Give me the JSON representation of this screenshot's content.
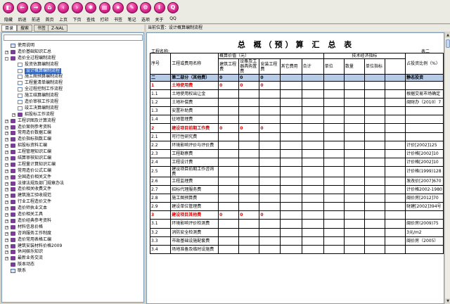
{
  "toolbar": {
    "buttons": [
      {
        "label": "隐藏",
        "icon": "hide-icon",
        "glyph": "◧"
      },
      {
        "label": "后退",
        "icon": "back-icon",
        "glyph": "←"
      },
      {
        "label": "前进",
        "icon": "forward-icon",
        "glyph": "→"
      },
      {
        "label": "首页",
        "icon": "home-icon",
        "glyph": "⌂"
      },
      {
        "label": "上页",
        "icon": "prev-page-icon",
        "glyph": "‹"
      },
      {
        "label": "下页",
        "icon": "next-page-icon",
        "glyph": "›"
      },
      {
        "label": "查找",
        "icon": "find-icon",
        "glyph": "✱"
      },
      {
        "label": "打印",
        "icon": "print-icon",
        "glyph": "▤"
      },
      {
        "label": "书签",
        "icon": "bookmark-icon",
        "glyph": "★"
      },
      {
        "label": "笔记",
        "icon": "note-icon",
        "glyph": "✎"
      },
      {
        "label": "选项",
        "icon": "options-icon",
        "glyph": "⚙"
      },
      {
        "label": "关于",
        "icon": "about-icon",
        "glyph": "i"
      },
      {
        "label": "QQ",
        "icon": "qq-icon",
        "glyph": "Q"
      }
    ],
    "accent": "#d9268c"
  },
  "tabs": [
    "目录",
    "搜索",
    "书签",
    "Z-NAL"
  ],
  "location": "当前位置：设计概算编制流程",
  "sidebar": {
    "tree": [
      {
        "label": "使用说明",
        "level": 0,
        "exp": "",
        "icon": "q"
      },
      {
        "label": "造价基础知识汇总",
        "level": 0,
        "exp": "+",
        "icon": "book"
      },
      {
        "label": "造价全过程编制流程",
        "level": 0,
        "exp": "-",
        "icon": "book"
      },
      {
        "label": "投资估算编制流程",
        "level": 1,
        "exp": "",
        "icon": "doc"
      },
      {
        "label": "设计概算编制流程",
        "level": 1,
        "exp": "",
        "icon": "doc",
        "selected": true
      },
      {
        "label": "施工图预算编制流程",
        "level": 1,
        "exp": "",
        "icon": "doc"
      },
      {
        "label": "工程量清单编制流程",
        "level": 1,
        "exp": "",
        "icon": "doc"
      },
      {
        "label": "全过程控制工作流程",
        "level": 1,
        "exp": "",
        "icon": "doc"
      },
      {
        "label": "施工结算编制流程",
        "level": 1,
        "exp": "",
        "icon": "doc"
      },
      {
        "label": "造价审核工作流程",
        "level": 1,
        "exp": "",
        "icon": "doc"
      },
      {
        "label": "竣工决算编制流程",
        "level": 1,
        "exp": "",
        "icon": "doc"
      },
      {
        "label": "招投标工作流程",
        "level": 1,
        "exp": "+",
        "icon": "book"
      },
      {
        "label": "工程识图及计算流程",
        "level": 0,
        "exp": "+",
        "icon": "book"
      },
      {
        "label": "造价案例参考资料",
        "level": 0,
        "exp": "+",
        "icon": "book"
      },
      {
        "label": "常用造价数据汇编",
        "level": 0,
        "exp": "+",
        "icon": "book"
      },
      {
        "label": "造价指标指数汇编",
        "level": 0,
        "exp": "+",
        "icon": "book"
      },
      {
        "label": "招投标资料汇编",
        "level": 0,
        "exp": "+",
        "icon": "book"
      },
      {
        "label": "工程管理知识汇编",
        "level": 0,
        "exp": "+",
        "icon": "book"
      },
      {
        "label": "结算审核知识汇编",
        "level": 0,
        "exp": "+",
        "icon": "book"
      },
      {
        "label": "工程量计算知识汇编",
        "level": 0,
        "exp": "+",
        "icon": "book"
      },
      {
        "label": "常用造价公式汇编",
        "level": 0,
        "exp": "+",
        "icon": "book"
      },
      {
        "label": "全国造价相关文件",
        "level": 0,
        "exp": "+",
        "icon": "book"
      },
      {
        "label": "法律法规及部门规章办法",
        "level": 0,
        "exp": "+",
        "icon": "book"
      },
      {
        "label": "造价相关收费文件",
        "level": 0,
        "exp": "+",
        "icon": "book"
      },
      {
        "label": "建筑施工验收规范",
        "level": 0,
        "exp": "+",
        "icon": "book"
      },
      {
        "label": "行业工程造价文件",
        "level": 0,
        "exp": "+",
        "icon": "book"
      },
      {
        "label": "造价师执业文本",
        "level": 0,
        "exp": "+",
        "icon": "book"
      },
      {
        "label": "造价相关工具",
        "level": 0,
        "exp": "+",
        "icon": "book"
      },
      {
        "label": "造价经典参考资料",
        "level": 0,
        "exp": "+",
        "icon": "book"
      },
      {
        "label": "材料信息价格",
        "level": 0,
        "exp": "+",
        "icon": "book"
      },
      {
        "label": "咨询服务工作制度",
        "level": 0,
        "exp": "+",
        "icon": "book"
      },
      {
        "label": "造价常用表格汇编",
        "level": 0,
        "exp": "+",
        "icon": "book"
      },
      {
        "label": "建筑安装材料价格2009",
        "level": 0,
        "exp": "+",
        "icon": "book"
      },
      {
        "label": "休闲娱乐知识",
        "level": 0,
        "exp": "+",
        "icon": "book"
      },
      {
        "label": "最新业务交流",
        "level": 0,
        "exp": "+",
        "icon": "book"
      },
      {
        "label": "版本动态",
        "level": 0,
        "exp": "",
        "icon": "book"
      },
      {
        "label": "联系",
        "level": 0,
        "exp": "",
        "icon": "q"
      }
    ]
  },
  "content": {
    "title": "总 概（预）算 汇 总 表",
    "project_label": "工程名称:",
    "table_label": "表二",
    "headers": {
      "no": "序号",
      "name": "工程或费用名称",
      "group_value": "概算价值（元）",
      "building": "建筑工程费",
      "equipment": "设备及工器具购置费",
      "install": "安装工程费",
      "other": "其它费用",
      "total": "合计",
      "group_tech": "技术经济指标",
      "unit": "单位",
      "qty": "数量",
      "unit_index": "单位指标",
      "ratio": "占投资比例（%）",
      "note": "备注及工程建设其他费用计算依据"
    },
    "rows": [
      {
        "type": "part",
        "no": "二",
        "name": "第二部分（其他费）",
        "b": "0",
        "e": "0",
        "i": "0",
        "note": "静态投资"
      },
      {
        "type": "sec",
        "no": "1",
        "name": "土地使用费",
        "b": "0",
        "e": "0",
        "i": "0",
        "note": ""
      },
      {
        "type": "item",
        "no": "1.1",
        "name": "土地使用权出让金",
        "note": "根据交易市场确定"
      },
      {
        "type": "item",
        "no": "1.2",
        "name": "土地补偿费",
        "note": "闽财办（2010）7"
      },
      {
        "type": "item",
        "no": "1.3",
        "name": "安置补助费",
        "note": ""
      },
      {
        "type": "item",
        "no": "1.4",
        "name": "征地管理费",
        "note": ""
      },
      {
        "type": "sec",
        "no": "2",
        "name": "建设项目前期工作费",
        "b": "0",
        "e": "0",
        "i": "0",
        "note": ""
      },
      {
        "type": "item",
        "no": "2.1",
        "name": "可行性研究费",
        "note": ""
      },
      {
        "type": "item",
        "no": "2.2",
        "name": "环境影响评价与评价费",
        "note": "计价[2002]125"
      },
      {
        "type": "item",
        "no": "2.3",
        "name": "工程勘察费",
        "note": "计价格[2002]10"
      },
      {
        "type": "item",
        "no": "2.4",
        "name": "工程设计费",
        "note": "计价格[2002]10"
      },
      {
        "type": "item",
        "no": "2.5",
        "name": "建设项目前期工作咨询费",
        "note": "计价格(1999)128"
      },
      {
        "type": "item",
        "no": "2.6",
        "name": "工程监理费",
        "note": "发改价[2007]670"
      },
      {
        "type": "item",
        "no": "2.7",
        "name": "招标代理服务费",
        "note": "计价格2002-1980"
      },
      {
        "type": "item",
        "no": "2.8",
        "name": "施工图预算费",
        "note": "闽价房[2012]70"
      },
      {
        "type": "item",
        "no": "2.9",
        "name": "建设单位管理费",
        "note": "财建[2002]394号"
      },
      {
        "type": "sec",
        "no": "3",
        "name": "建设项目其他费",
        "b": "0",
        "e": "0",
        "i": "0",
        "note": ""
      },
      {
        "type": "item",
        "no": "3.1",
        "name": "环境影响评价检测费",
        "note": "闽价房(2009)75"
      },
      {
        "type": "item",
        "no": "3.2",
        "name": "消防安全检测费",
        "note": "3元/m2"
      },
      {
        "type": "item",
        "no": "3.3",
        "name": "市政基础设施配套费",
        "note": "闽价房（2005）"
      },
      {
        "type": "item",
        "no": "3.4",
        "name": "场地准备及临时设施费",
        "note": ""
      }
    ]
  }
}
